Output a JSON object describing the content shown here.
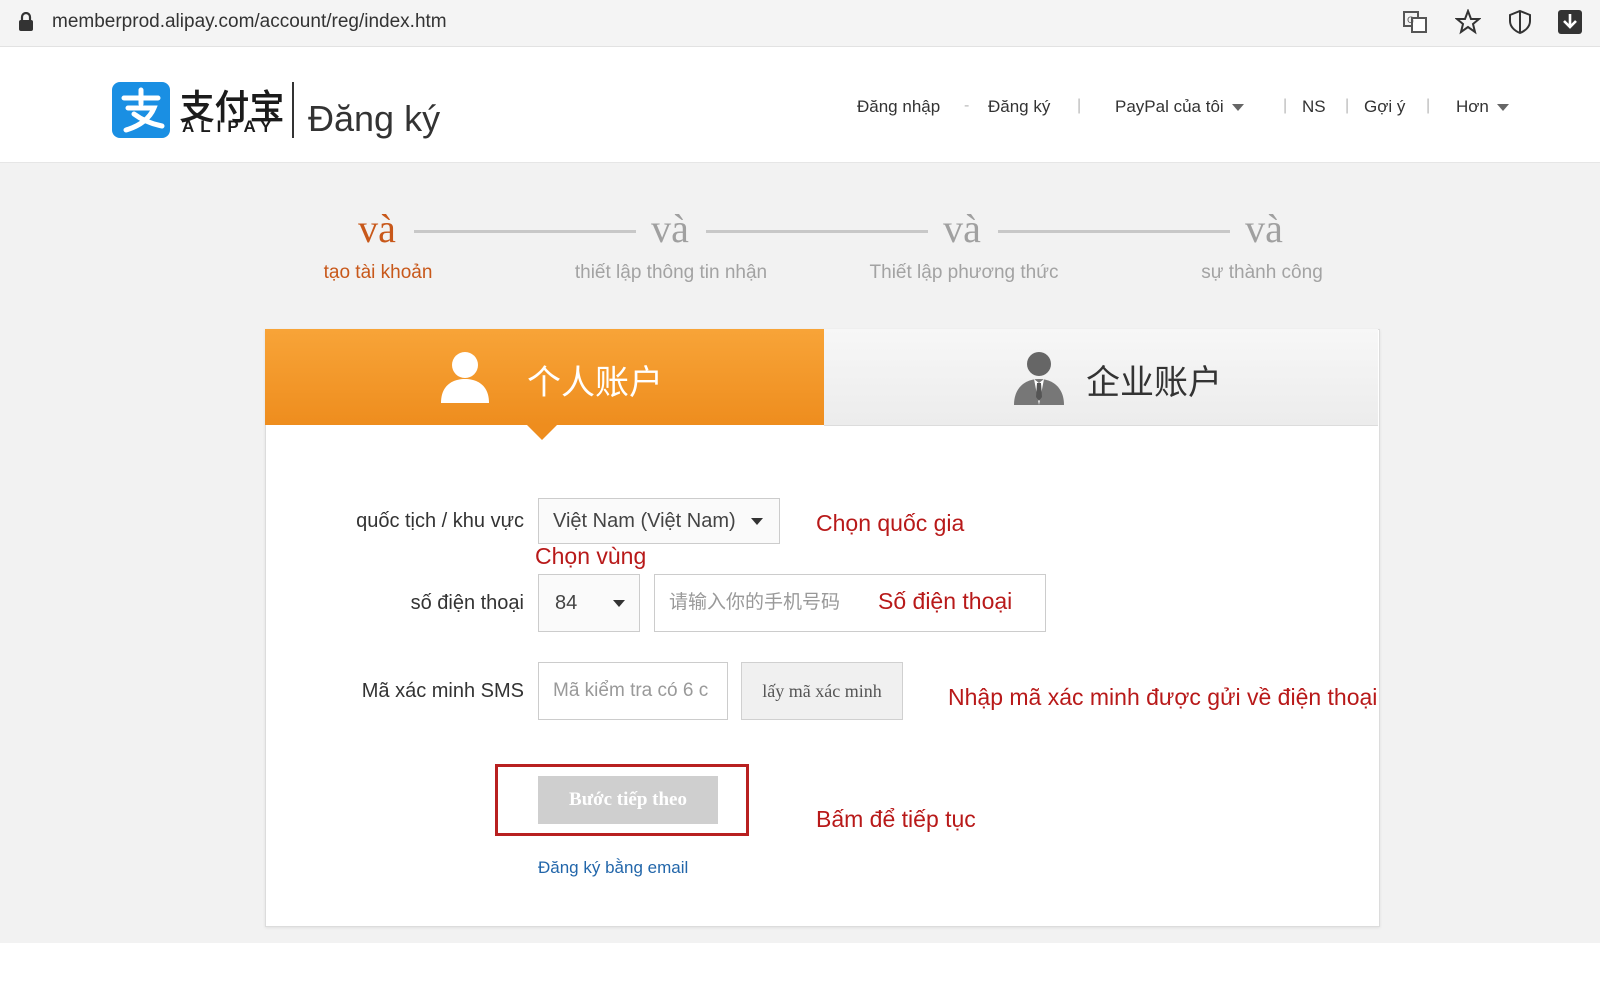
{
  "browser": {
    "url": "memberprod.alipay.com/account/reg/index.htm",
    "icons": [
      "translate-icon",
      "star-icon",
      "shield-icon",
      "download-icon"
    ]
  },
  "header": {
    "logo_cn": "支付宝",
    "logo_en": "ALIPAY",
    "page_title": "Đăng ký",
    "nav": {
      "login": "Đăng nhập",
      "register": "Đăng ký",
      "my_paypal": "PayPal của tôi",
      "ns": "NS",
      "suggest": "Gợi ý",
      "more": "Hơn"
    }
  },
  "steps": [
    {
      "symbol": "và",
      "label": "tạo tài khoản",
      "active": true
    },
    {
      "symbol": "và",
      "label": "thiết lập thông tin nhận",
      "active": false
    },
    {
      "symbol": "và",
      "label": "Thiết lập phương thức",
      "active": false
    },
    {
      "symbol": "và",
      "label": "sự thành công",
      "active": false
    }
  ],
  "tabs": {
    "personal": "个人账户",
    "business": "企业账户"
  },
  "form": {
    "nationality_label": "quốc tịch / khu vực",
    "nationality_value": "Việt Nam (Việt Nam)",
    "phone_label": "số điện thoại",
    "area_code": "84",
    "phone_placeholder": "请输入你的手机号码",
    "sms_label": "Mã xác minh SMS",
    "sms_placeholder": "Mã kiểm tra có 6 c",
    "get_code_button": "lấy mã xác minh",
    "next_button": "Bước tiếp theo",
    "email_link": "Đăng ký bằng email"
  },
  "annotations": {
    "choose_country": "Chọn quốc gia",
    "choose_region": "Chọn vùng",
    "phone_number": "Số điện thoại",
    "enter_code": "Nhập mã xác minh được gửi về điện thoại",
    "click_continue": "Bấm để tiếp tục"
  },
  "colors": {
    "accent_orange": "#ee8d1e",
    "step_active": "#c8581a",
    "annotation_red": "#b81919",
    "alipay_blue": "#1a8fe3"
  }
}
